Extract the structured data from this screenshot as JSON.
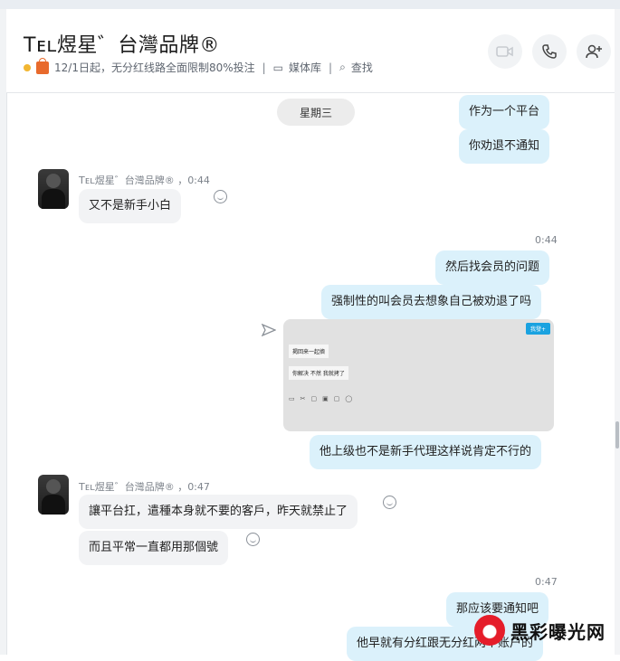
{
  "header": {
    "title": "Tᴇʟ煜星゛台灣品牌®",
    "date_note": "12/1日起，无分红线路全面限制80%投注",
    "media_label": "媒体库",
    "search_label": "查找",
    "separator": "|"
  },
  "day_label": "星期三",
  "messages": {
    "out1": "作为一个平台",
    "out2": "你劝退不通知",
    "in_sender1": "Tᴇʟ煜星゛台灣品牌® ，0:44",
    "in1": "又不是新手小白",
    "time2": "0:44",
    "out3": "然后找会员的问题",
    "out4": "强制性的叫会员去想象自己被劝退了吗",
    "out5": "他上级也不是新手代理这样说肯定不行的",
    "in_sender2": "Tᴇʟ煜星゛台灣品牌® ，0:47",
    "in2": "讓平台扛，遣種本身就不要的客戶，昨天就禁止了",
    "in3": "而且平常一直都用那個號",
    "time3": "0:47",
    "out6": "那应该要通知吧",
    "out7": "他早就有分红跟无分红两个账户的"
  },
  "screenshot_preview": {
    "tag": "我發+",
    "line1": "掲回来一起擠",
    "line2": "你解决 不然 我就拷了"
  },
  "watermark": "黑彩曝光网"
}
